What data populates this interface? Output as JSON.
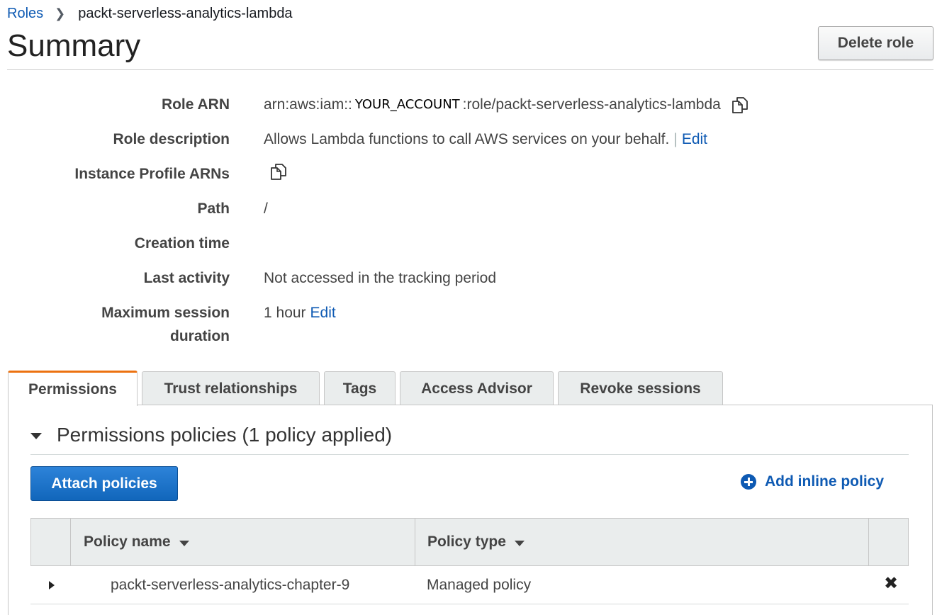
{
  "breadcrumb": {
    "root": "Roles",
    "current": "packt-serverless-analytics-lambda"
  },
  "page_title": "Summary",
  "delete_button": "Delete role",
  "summary": {
    "role_arn_label": "Role ARN",
    "role_arn_prefix": "arn:aws:iam::",
    "role_arn_account": "YOUR_ACCOUNT",
    "role_arn_suffix": ":role/packt-serverless-analytics-lambda",
    "role_description_label": "Role description",
    "role_description_value": "Allows Lambda functions to call AWS services on your behalf.",
    "role_description_separator": "|",
    "edit_label": "Edit",
    "instance_profile_label": "Instance Profile ARNs",
    "path_label": "Path",
    "path_value": "/",
    "creation_time_label": "Creation time",
    "last_activity_label": "Last activity",
    "last_activity_value": "Not accessed in the tracking period",
    "max_session_label_line1": "Maximum session",
    "max_session_label_line2": "duration",
    "max_session_value": "1 hour"
  },
  "tabs": [
    {
      "label": "Permissions",
      "active": true
    },
    {
      "label": "Trust relationships",
      "active": false
    },
    {
      "label": "Tags",
      "active": false
    },
    {
      "label": "Access Advisor",
      "active": false
    },
    {
      "label": "Revoke sessions",
      "active": false
    }
  ],
  "permissions": {
    "section_title": "Permissions policies (1 policy applied)",
    "attach_button": "Attach policies",
    "add_inline_button": "Add inline policy",
    "columns": [
      "Policy name",
      "Policy type"
    ],
    "rows": [
      {
        "policy_name": "packt-serverless-analytics-chapter-9",
        "policy_type": "Managed policy"
      }
    ]
  },
  "colors": {
    "link": "#0e5ab3",
    "primary_button": "#1166bb",
    "active_tab_accent": "#ec7211"
  },
  "icons": {
    "copy": "copy-icon",
    "expand": "caret-right-icon",
    "remove": "close-icon",
    "add": "plus-circle-icon"
  }
}
